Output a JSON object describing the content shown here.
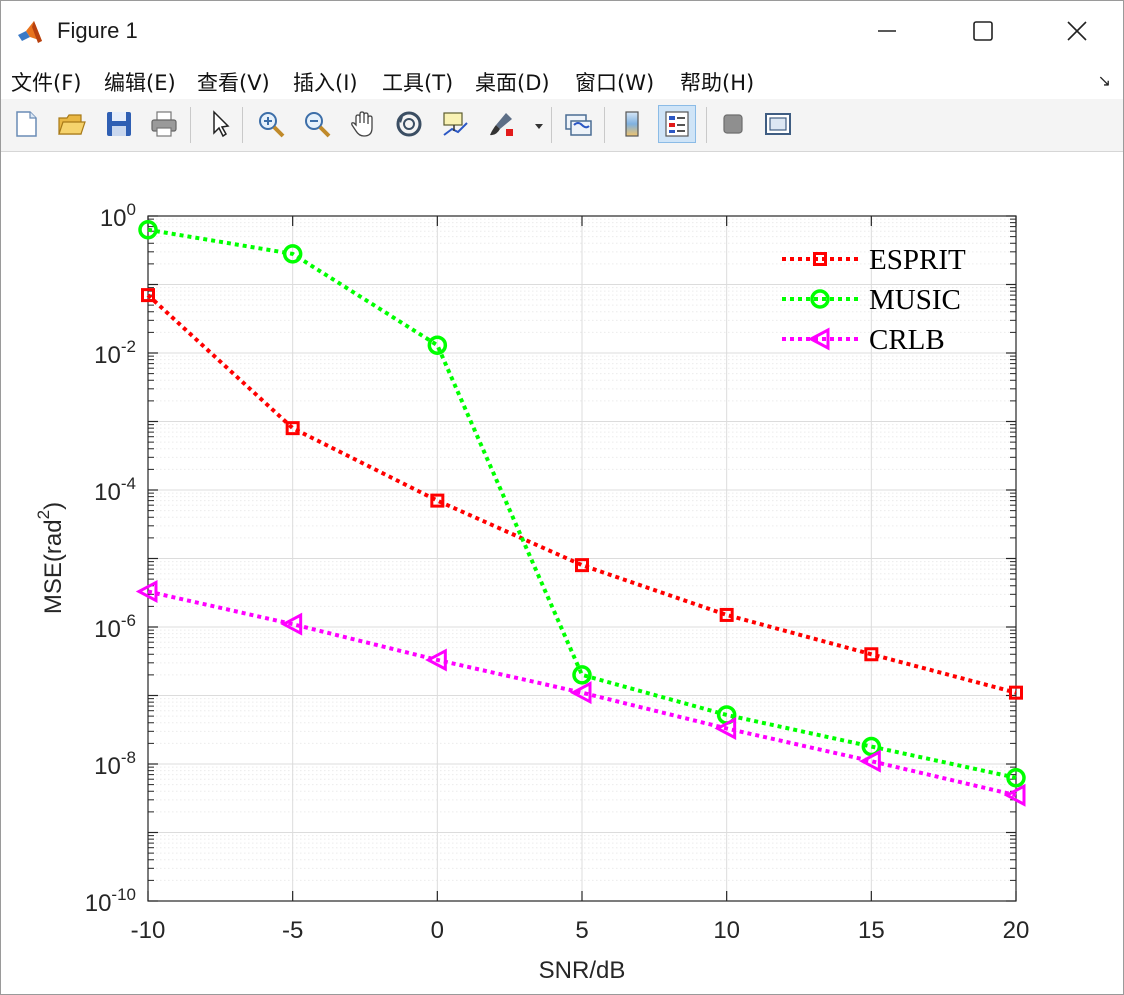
{
  "window": {
    "title": "Figure 1",
    "controls": {
      "minimize_icon": "minimize-icon",
      "maximize_icon": "maximize-icon",
      "close_icon": "close-icon"
    }
  },
  "menu": {
    "items": [
      "文件(F)",
      "编辑(E)",
      "查看(V)",
      "插入(I)",
      "工具(T)",
      "桌面(D)",
      "窗口(W)",
      "帮助(H)"
    ],
    "corner_icon": "↘"
  },
  "toolbar": {
    "icons": [
      "new-figure-icon",
      "open-icon",
      "save-icon",
      "print-icon",
      "pointer-icon",
      "zoom-in-icon",
      "zoom-out-icon",
      "pan-icon",
      "rotate-3d-icon",
      "data-cursor-icon",
      "brush-icon",
      "link-plot-icon",
      "colorbar-icon",
      "legend-icon",
      "hide-plot-tools-icon",
      "show-plot-tools-icon"
    ]
  },
  "colors": {
    "esprit": "#ff0000",
    "music": "#00ff00",
    "crlb": "#ff00ff",
    "grid_major": "#dcdcdc",
    "grid_minor": "#ececec"
  },
  "chart_data": {
    "type": "line",
    "xlabel": "SNR/dB",
    "ylabel": "MSE(rad",
    "ylabel_sup": "2",
    "ylabel_close": ")",
    "yscale": "log",
    "xlim": [
      -10,
      20
    ],
    "ylim": [
      1e-10,
      1
    ],
    "grid": true,
    "legend_position": "top-right",
    "x": [
      -10,
      -5,
      0,
      5,
      10,
      15,
      20
    ],
    "x_ticks": [
      "-10",
      "-5",
      "0",
      "5",
      "10",
      "15",
      "20"
    ],
    "y_ticks": [
      {
        "base": "10",
        "exp": "0"
      },
      {
        "base": "10",
        "exp": "-2"
      },
      {
        "base": "10",
        "exp": "-4"
      },
      {
        "base": "10",
        "exp": "-6"
      },
      {
        "base": "10",
        "exp": "-8"
      },
      {
        "base": "10",
        "exp": "-10"
      }
    ],
    "series": [
      {
        "name": "ESPRIT",
        "marker": "square",
        "color": "#ff0000",
        "values": [
          0.07,
          0.0008,
          7e-05,
          8e-06,
          1.5e-06,
          4e-07,
          1.1e-07
        ]
      },
      {
        "name": "MUSIC",
        "marker": "circle",
        "color": "#00ff00",
        "values": [
          0.63,
          0.28,
          0.013,
          2e-07,
          5.2e-08,
          1.8e-08,
          6.3e-09
        ]
      },
      {
        "name": "CRLB",
        "marker": "triangle-left",
        "color": "#ff00ff",
        "values": [
          3.3e-06,
          1.1e-06,
          3.3e-07,
          1.1e-07,
          3.3e-08,
          1.1e-08,
          3.5e-09
        ]
      }
    ]
  }
}
